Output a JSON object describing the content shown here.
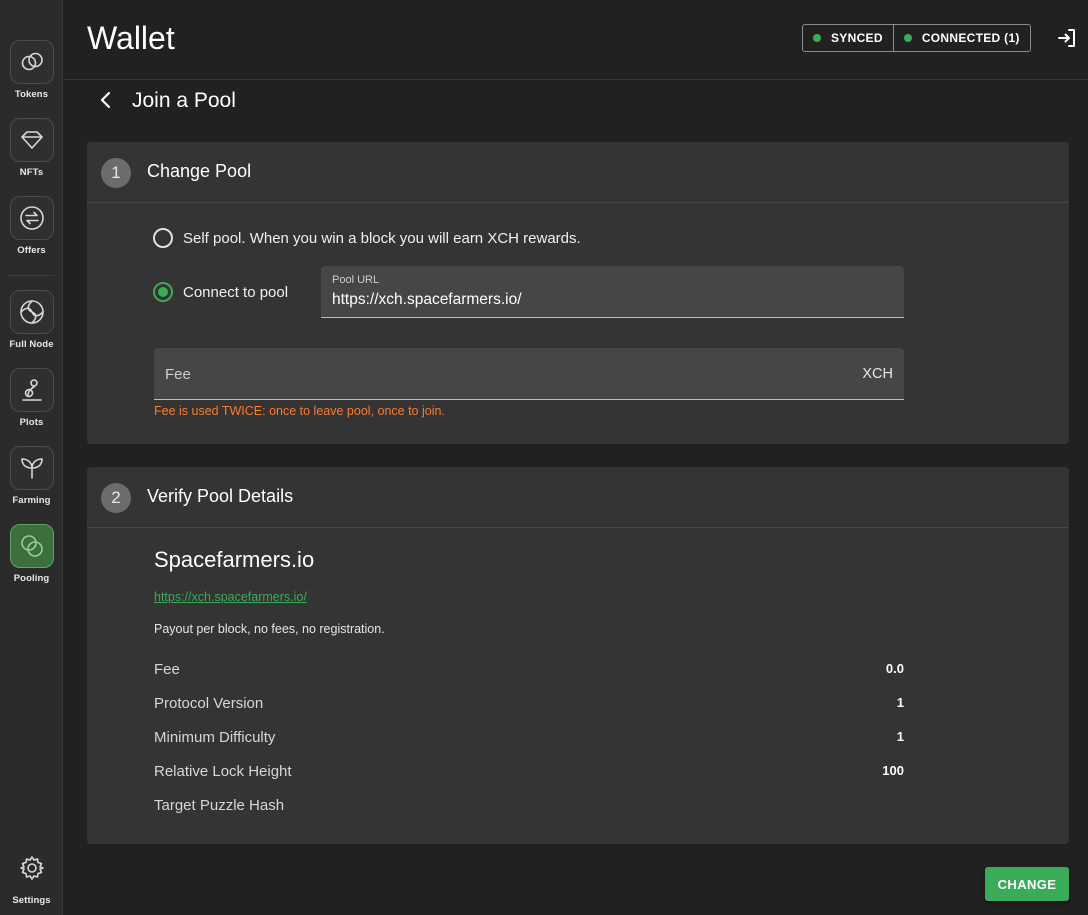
{
  "sidebar": {
    "items": [
      {
        "label": "Tokens",
        "icon": "tokens-icon"
      },
      {
        "label": "NFTs",
        "icon": "diamond-icon"
      },
      {
        "label": "Offers",
        "icon": "swap-icon"
      },
      {
        "label": "Full Node",
        "icon": "full-node-icon"
      },
      {
        "label": "Plots",
        "icon": "plots-icon"
      },
      {
        "label": "Farming",
        "icon": "sprout-icon"
      },
      {
        "label": "Pooling",
        "icon": "pooling-icon"
      },
      {
        "label": "Settings",
        "icon": "gear-icon"
      }
    ],
    "active": "Pooling"
  },
  "header": {
    "title": "Wallet",
    "status": {
      "synced": "SYNCED",
      "connected": "CONNECTED (1)"
    },
    "status_color": "#3aac59"
  },
  "page": {
    "title": "Join a Pool"
  },
  "change_pool": {
    "step": "1",
    "title": "Change Pool",
    "self_pool_label": "Self pool. When you win a block you will earn XCH rewards.",
    "connect_label": "Connect to pool",
    "selected": "connect",
    "pool_url": {
      "label": "Pool URL",
      "value": "https://xch.spacefarmers.io/"
    },
    "fee": {
      "placeholder": "Fee",
      "suffix": "XCH"
    },
    "fee_warning": "Fee is used TWICE: once to leave pool, once to join."
  },
  "verify": {
    "step": "2",
    "title": "Verify Pool Details",
    "pool_name": "Spacefarmers.io",
    "pool_link": "https://xch.spacefarmers.io/",
    "description": "Payout per block, no fees, no registration.",
    "details": [
      {
        "label": "Fee",
        "value": "0.0"
      },
      {
        "label": "Protocol Version",
        "value": "1"
      },
      {
        "label": "Minimum Difficulty",
        "value": "1"
      },
      {
        "label": "Relative Lock Height",
        "value": "100"
      },
      {
        "label": "Target Puzzle Hash",
        "value": ""
      }
    ]
  },
  "actions": {
    "change_label": "CHANGE"
  },
  "colors": {
    "accent": "#3aac59",
    "warning": "#ff7a29",
    "background": "#212121",
    "card": "#343434"
  }
}
